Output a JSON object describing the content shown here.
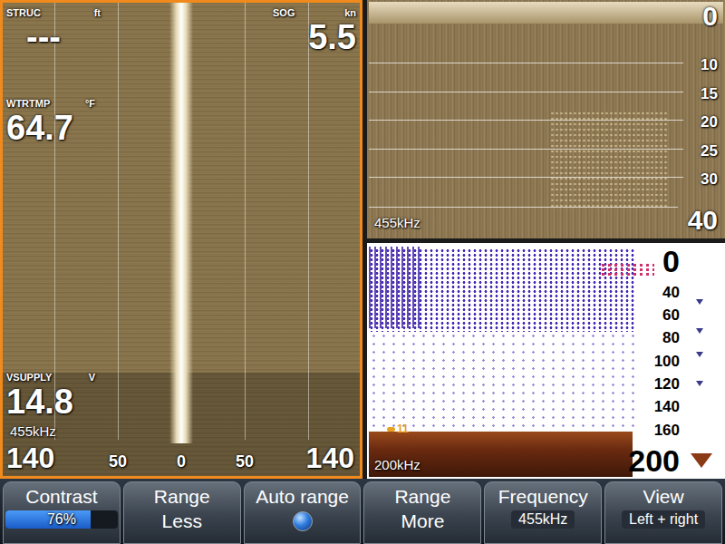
{
  "side_scan": {
    "selected": true,
    "frequency": "455kHz",
    "range_left": "140",
    "range_right": "140",
    "scale": [
      "50",
      "0",
      "50"
    ],
    "readouts": [
      {
        "label": "STRUC",
        "unit": "ft",
        "value": "---"
      },
      {
        "label": "SOG",
        "unit": "kn",
        "value": "5.5"
      },
      {
        "label": "WTRTMP",
        "unit": "°F",
        "value": "64.7"
      },
      {
        "label": "VSUPPLY",
        "unit": "V",
        "value": "14.8"
      }
    ]
  },
  "down_scan": {
    "selected": false,
    "frequency": "455kHz",
    "depths": [
      "0",
      "10",
      "15",
      "20",
      "25",
      "30",
      "40"
    ]
  },
  "sonar": {
    "selected": false,
    "frequency": "200kHz",
    "depths": [
      "0",
      "40",
      "60",
      "80",
      "100",
      "120",
      "140",
      "160",
      "200"
    ],
    "fish_marks": [
      "11"
    ]
  },
  "softkeys": [
    {
      "label": "Contrast",
      "kind": "slider",
      "level": 0.76,
      "value": "76%"
    },
    {
      "label": "Range",
      "kind": "button",
      "value": "Less"
    },
    {
      "label": "Auto range",
      "kind": "toggle",
      "on": true
    },
    {
      "label": "Range",
      "kind": "button",
      "value": "More"
    },
    {
      "label": "Frequency",
      "kind": "option",
      "value": "455kHz"
    },
    {
      "label": "View",
      "kind": "option",
      "value": "Left + right"
    }
  ]
}
